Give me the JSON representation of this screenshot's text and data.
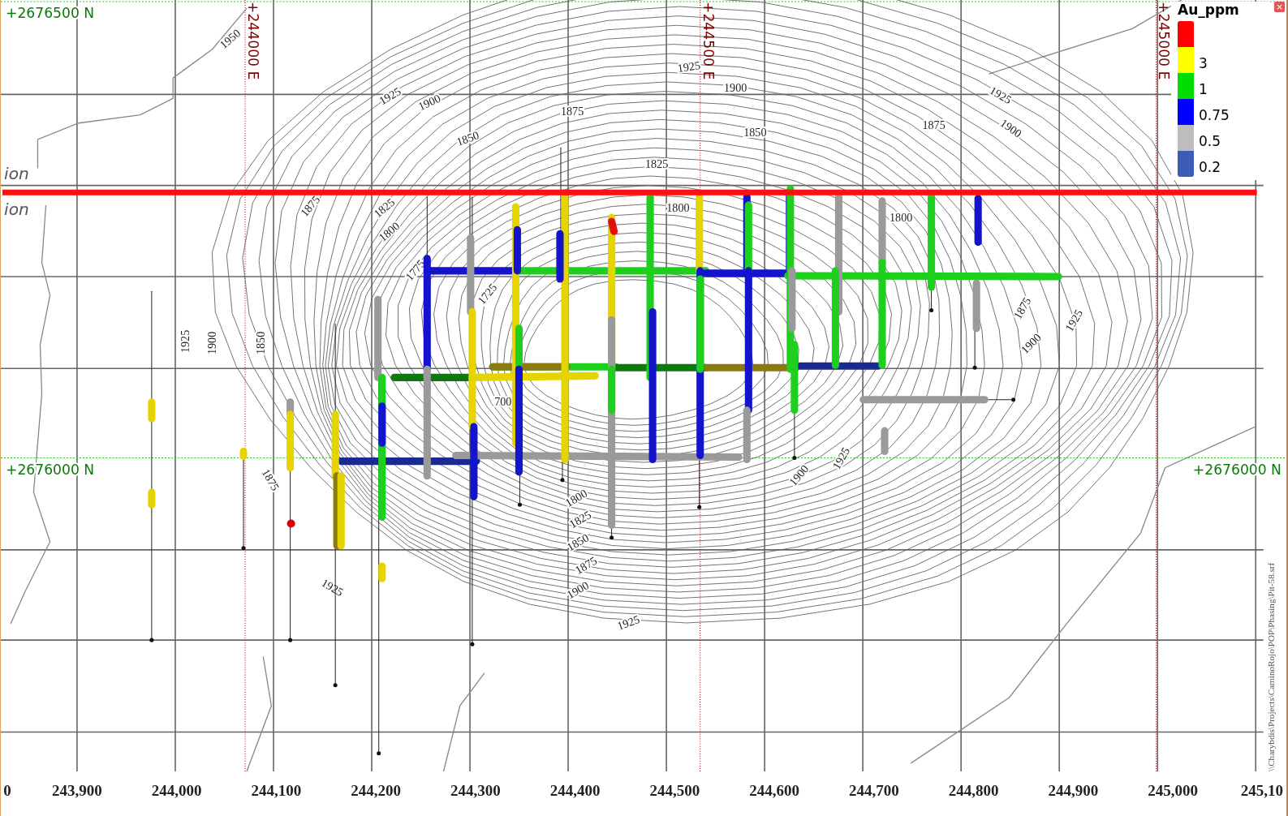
{
  "map": {
    "northing_labels": [
      "+2676500 N",
      "+2676000 N",
      "+2676000 N"
    ],
    "easting_labels": [
      "+244000 E",
      "+244500 E",
      "+245000 E"
    ],
    "section_labels": [
      "ion",
      "ion"
    ],
    "contour_labels": [
      "1950",
      "1925",
      "1900",
      "1850",
      "1875",
      "1925",
      "1900",
      "1850",
      "1825",
      "1875",
      "1925",
      "1900",
      "1875",
      "1825",
      "1800",
      "1775",
      "1725",
      "1925",
      "1900",
      "1850",
      "1875",
      "1925",
      "1900",
      "1925",
      "1875",
      "1925",
      "1900",
      "1800",
      "1825",
      "1850",
      "1875",
      "1900",
      "1925",
      "1800",
      "1800",
      "700"
    ],
    "file_path": "\\\\Charybdis\\Projects\\CaminoRojo\\POP\\Phasing\\Pit-58.srf"
  },
  "legend": {
    "title": "Au_ppm",
    "close": "×",
    "entries": [
      {
        "color": "#ff0000"
      },
      {
        "color": "#ffff00",
        "label": "3"
      },
      {
        "color": "#00dd00",
        "label": "1"
      },
      {
        "color": "#0000ff",
        "label": "0.75"
      },
      {
        "color": "#bdbdbd",
        "label": "0.5"
      },
      {
        "color": "#3d5cb8",
        "label": "0.2"
      }
    ]
  },
  "x_axis": {
    "ticks": [
      "0",
      "243,900",
      "244,000",
      "244,100",
      "244,200",
      "244,300",
      "244,400",
      "244,500",
      "244,600",
      "244,700",
      "244,800",
      "244,900",
      "245,000",
      "245,10"
    ]
  }
}
